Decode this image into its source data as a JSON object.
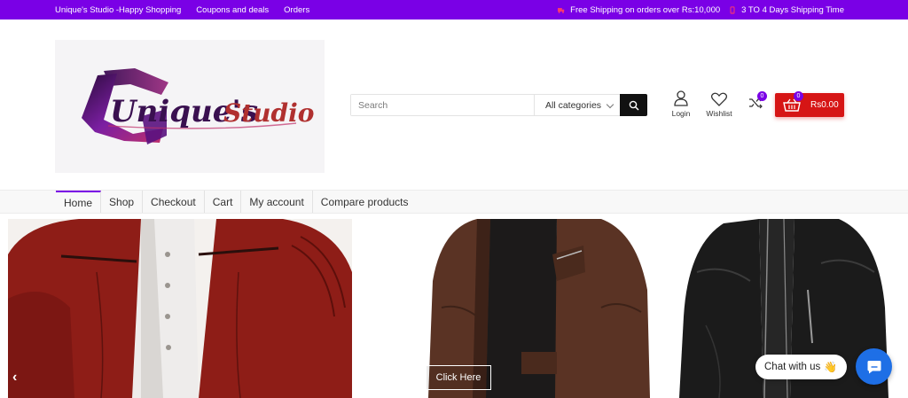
{
  "topbar": {
    "links": [
      "Unique's Studio -Happy Shopping",
      "Coupons and deals",
      "Orders"
    ],
    "shipping_free": "Free Shipping on orders over Rs:10,000",
    "shipping_time": "3 TO 4 Days Shipping Time",
    "bg_color": "#7a00e6"
  },
  "header": {
    "logo_text": "Unique's Studio",
    "search": {
      "placeholder": "Search",
      "category": "All categories"
    },
    "login_label": "Login",
    "wishlist_label": "Wishlist",
    "compare_count": "0",
    "cart_count": "0",
    "cart_total": "Rs0.00",
    "cart_color": "#d61515"
  },
  "nav": {
    "items": [
      "Home",
      "Shop",
      "Checkout",
      "Cart",
      "My account",
      "Compare products"
    ],
    "active": "Home"
  },
  "slider": {
    "prev_arrow": "‹",
    "button_label": "Click Here"
  },
  "chat": {
    "label": "Chat with us",
    "emoji": "👋",
    "button_color": "#1e6fe6"
  }
}
